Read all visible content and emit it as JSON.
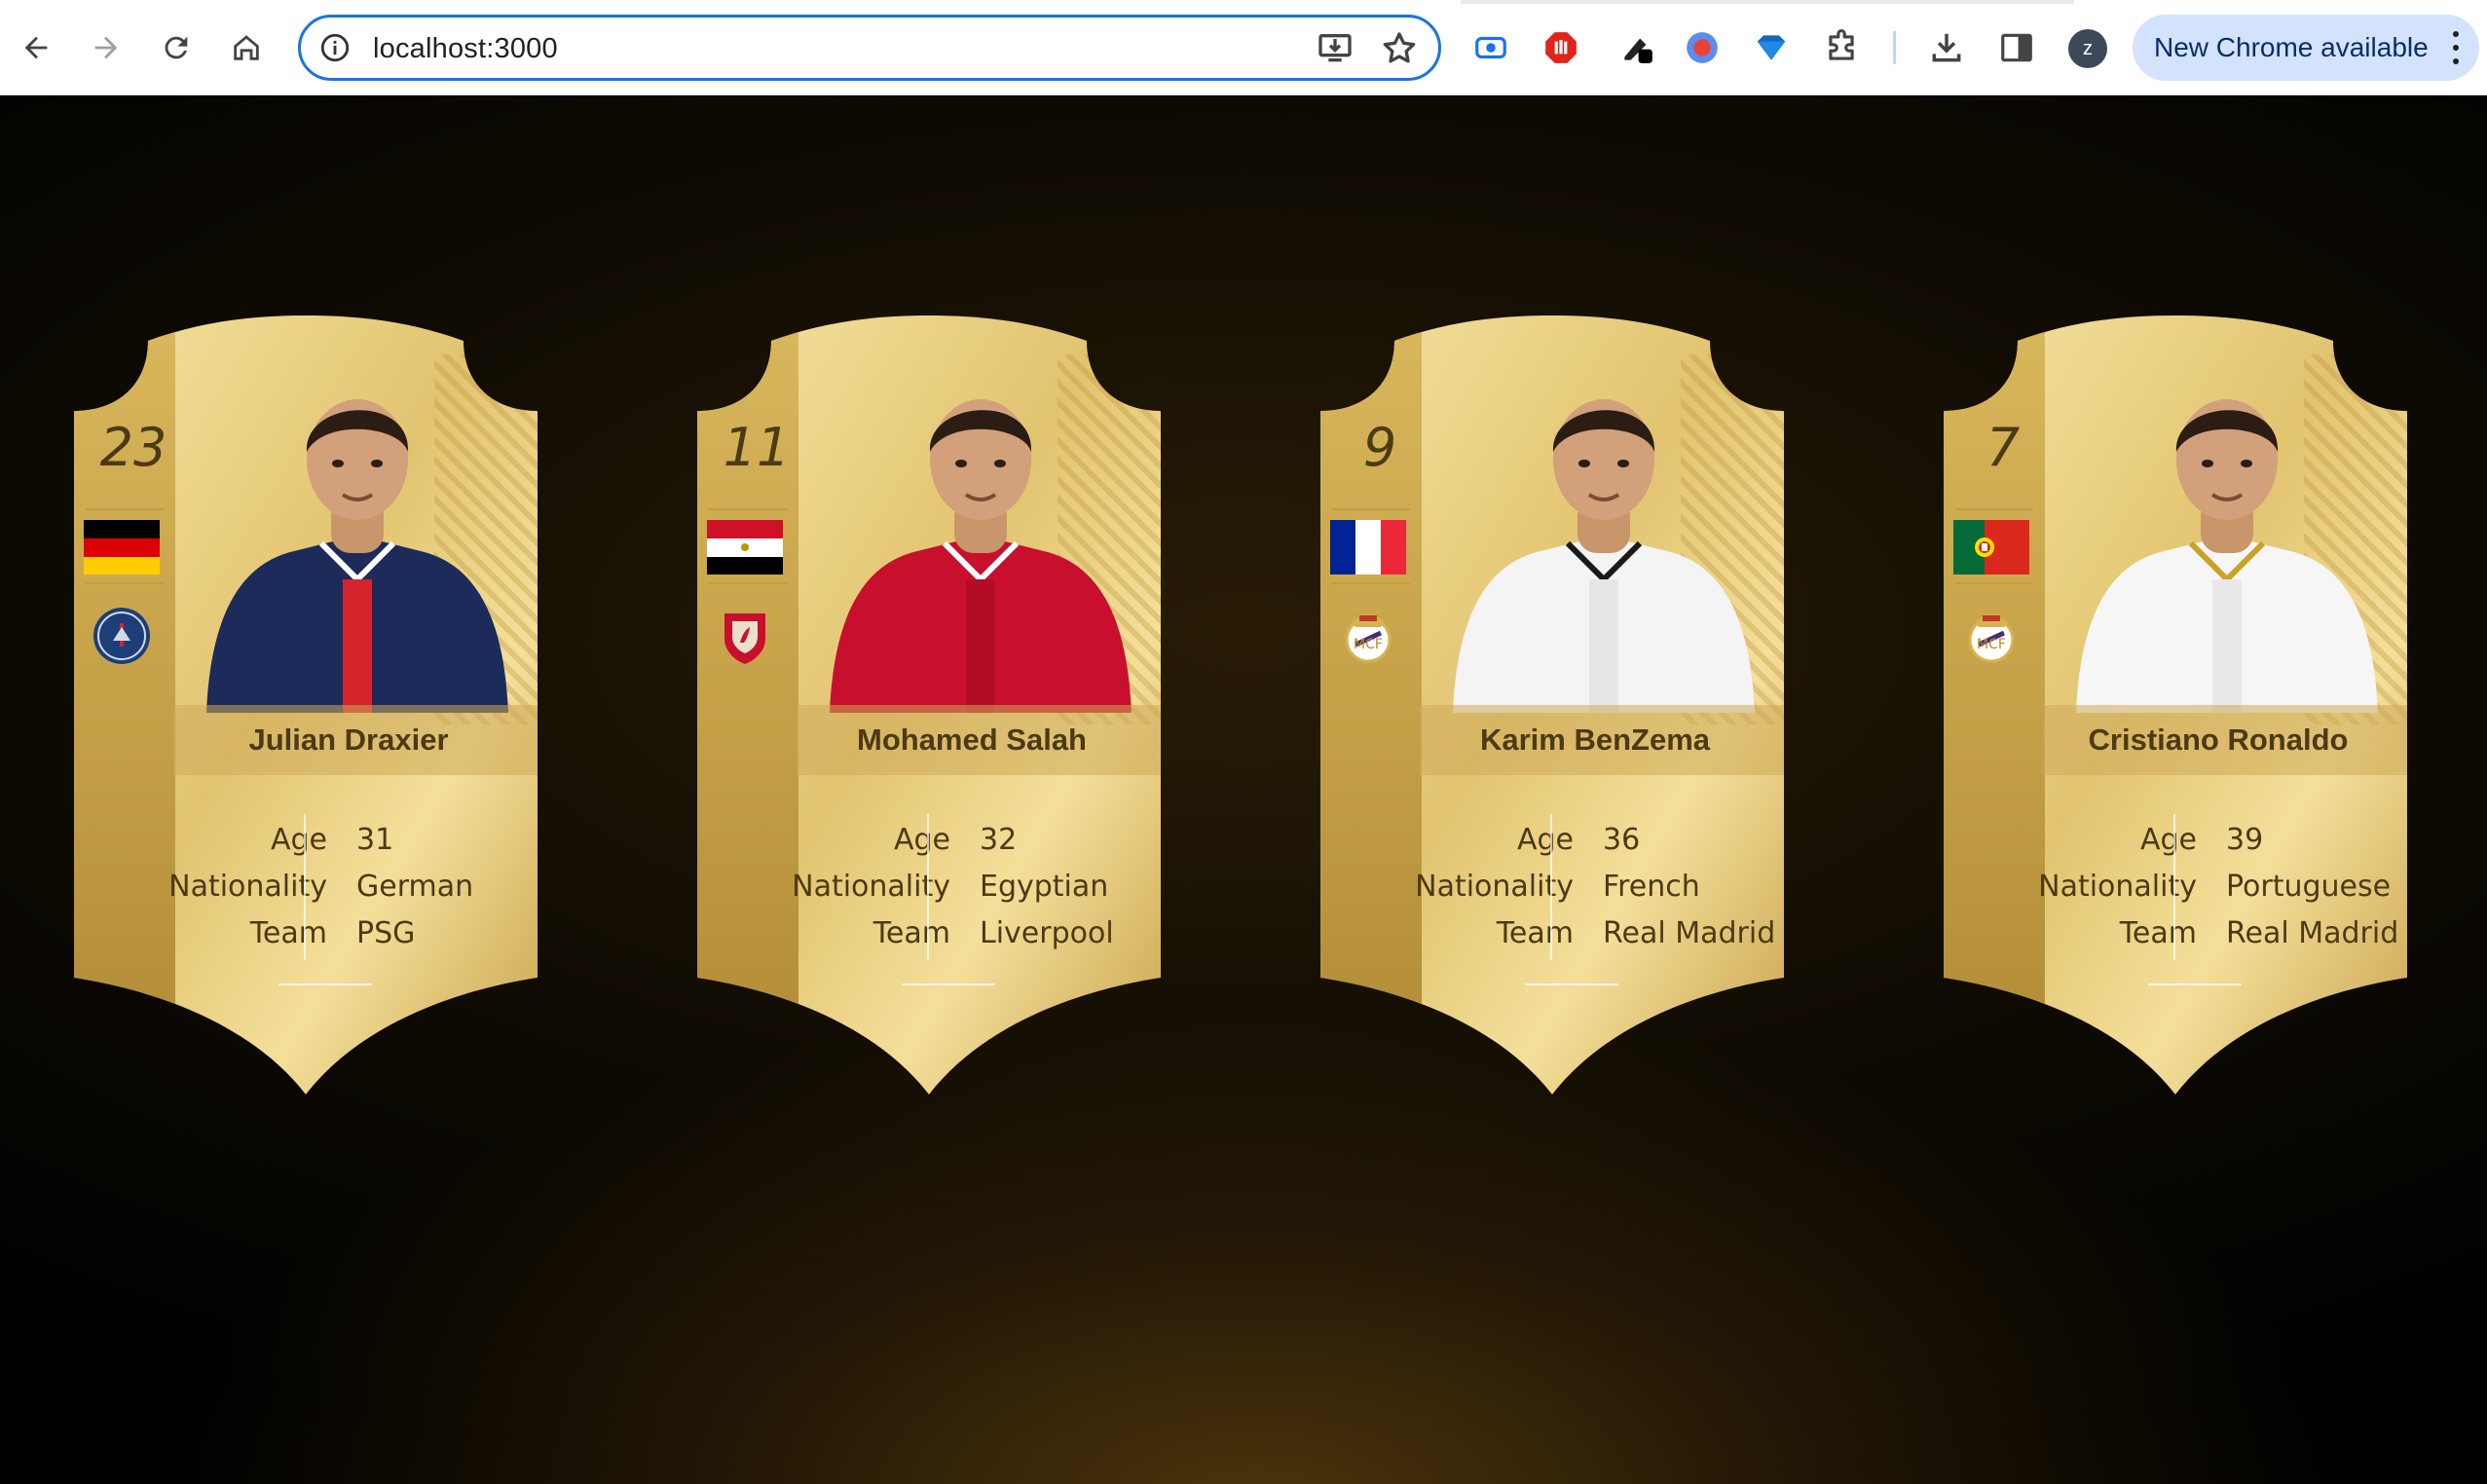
{
  "browser": {
    "url": "localhost:3000",
    "profile_initial": "z",
    "update_label": "New Chrome available"
  },
  "players": [
    {
      "rating": "23",
      "name": "Julian Draxier",
      "labels": [
        "Age",
        "Nationality",
        "Team"
      ],
      "values": [
        "31",
        "German",
        "PSG"
      ],
      "flag": "germany-flag",
      "crest": "psg-crest",
      "kit": {
        "shirt": "#1c2b5a",
        "stripe": "#d6242c",
        "trim": "#ffffff"
      }
    },
    {
      "rating": "11",
      "name": "Mohamed Salah",
      "labels": [
        "Age",
        "Nationality",
        "Team"
      ],
      "values": [
        "32",
        "Egyptian",
        "Liverpool"
      ],
      "flag": "egypt-flag",
      "crest": "liverpool-crest",
      "kit": {
        "shirt": "#c8102e",
        "stripe": "#b30d26",
        "trim": "#ffffff"
      }
    },
    {
      "rating": "9",
      "name": "Karim BenZema",
      "labels": [
        "Age",
        "Nationality",
        "Team"
      ],
      "values": [
        "36",
        "French",
        "Real Madrid"
      ],
      "flag": "france-flag",
      "crest": "real-madrid-crest",
      "kit": {
        "shirt": "#f4f4f4",
        "stripe": "#e6e6e6",
        "trim": "#1a1a1a"
      }
    },
    {
      "rating": "7",
      "name": "Cristiano Ronaldo",
      "labels": [
        "Age",
        "Nationality",
        "Team"
      ],
      "values": [
        "39",
        "Portuguese",
        "Real Madrid"
      ],
      "flag": "portugal-flag",
      "crest": "real-madrid-crest",
      "kit": {
        "shirt": "#f6f6f6",
        "stripe": "#e8e8e8",
        "trim": "#c9a227"
      }
    }
  ]
}
